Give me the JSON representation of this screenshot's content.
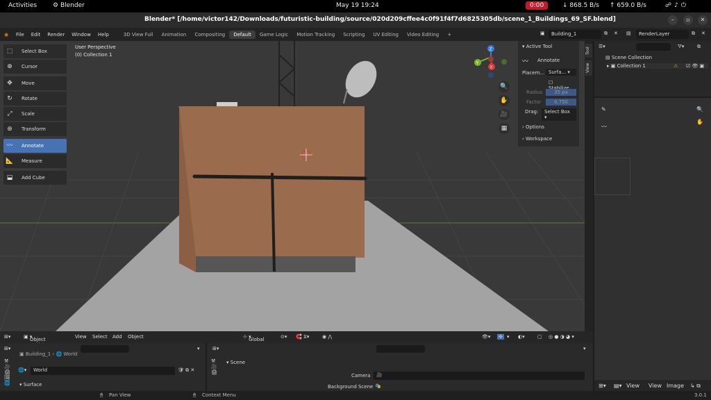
{
  "system_bar": {
    "activities": "Activities",
    "app_name": "Blender",
    "datetime": "May 19  19:24",
    "record_timer": "0:00",
    "net_down": "868.5 B/s",
    "net_up": "659.0 B/s"
  },
  "window": {
    "title": "Blender* [/home/victor142/Downloads/futuristic-building/source/020d209cffee4c0f91f4f7d6825305db/scene_1_Buildings_69_SF.blend]"
  },
  "menu": {
    "items": [
      "File",
      "Edit",
      "Render",
      "Window",
      "Help"
    ],
    "workspaces": [
      "3D View Full",
      "Animation",
      "Compositing",
      "Default",
      "Game Logic",
      "Motion Tracking",
      "Scripting",
      "UV Editing",
      "Video Editing"
    ],
    "active_workspace": "Default",
    "add_workspace": "+",
    "scene_field": "Building_1",
    "view_layer_field": "RenderLayer"
  },
  "viewport": {
    "perspective_label": "User Perspective",
    "collection_label": "(0) Collection 1",
    "tools": [
      {
        "label": "Select Box",
        "icon": "select-box-icon"
      },
      {
        "label": "Cursor",
        "icon": "cursor-icon"
      },
      {
        "label": "Move",
        "icon": "move-icon"
      },
      {
        "label": "Rotate",
        "icon": "rotate-icon"
      },
      {
        "label": "Scale",
        "icon": "scale-icon"
      },
      {
        "label": "Transform",
        "icon": "transform-icon"
      },
      {
        "label": "Annotate",
        "icon": "annotate-icon"
      },
      {
        "label": "Measure",
        "icon": "measure-icon"
      },
      {
        "label": "Add Cube",
        "icon": "add-cube-icon"
      }
    ],
    "active_tool": "Annotate",
    "gizmo_axes": {
      "x": "X",
      "y": "Y",
      "z": "Z"
    },
    "colors": {
      "x_axis": "#e3373c",
      "y_axis": "#79b727",
      "z_axis": "#3b7ddd",
      "accent": "#4772b3"
    }
  },
  "sidebar": {
    "tabs": [
      "Tool",
      "View"
    ],
    "active_tool_header": "Active Tool",
    "tool_name": "Annotate",
    "placement_label": "Placem...",
    "placement_value": "Surfa...",
    "stabilize_label": "Stabilize...",
    "radius_label": "Radius",
    "radius_value": "35 px",
    "factor_label": "Factor",
    "factor_value": "0.750",
    "drag_label": "Drag:",
    "drag_value": "Select Box",
    "options_label": "Options",
    "workspace_label": "Workspace"
  },
  "viewport_header": {
    "mode": "Object Mode",
    "menus": [
      "View",
      "Select",
      "Add",
      "Object"
    ],
    "transform_orientation": "Global"
  },
  "outliner": {
    "root": "Scene Collection",
    "child": "Collection 1"
  },
  "properties_left": {
    "breadcrumb_object": "Building_1",
    "breadcrumb_world": "World",
    "world_field": "World",
    "surface_panel": "Surface"
  },
  "properties_right": {
    "scene_panel": "Scene",
    "camera_label": "Camera",
    "background_scene_label": "Background Scene"
  },
  "image_editor_header": {
    "menus": [
      "View",
      "View",
      "Image"
    ]
  },
  "status_bar": {
    "pan_view": "Pan View",
    "context_menu": "Context Menu",
    "version": "3.0.1"
  }
}
